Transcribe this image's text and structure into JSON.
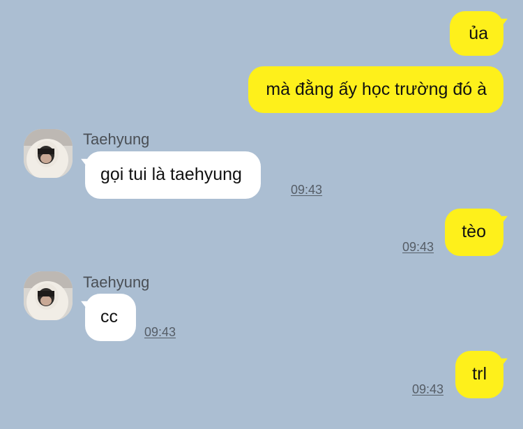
{
  "messages": [
    {
      "direction": "outgoing",
      "text": "ủa"
    },
    {
      "direction": "outgoing",
      "text": "mà đằng ấy học trường đó à"
    },
    {
      "direction": "incoming",
      "sender": "Taehyung",
      "text": "gọi tui là taehyung",
      "time": "09:43"
    },
    {
      "direction": "outgoing",
      "text": "tèo",
      "time": "09:43"
    },
    {
      "direction": "incoming",
      "sender": "Taehyung",
      "text": "cc",
      "time": "09:43"
    },
    {
      "direction": "outgoing",
      "text": "trl",
      "time": "09:43"
    }
  ],
  "colors": {
    "background": "#abbed2",
    "outgoing_bubble": "#fef01b",
    "incoming_bubble": "#ffffff",
    "timestamp": "#555d66"
  }
}
